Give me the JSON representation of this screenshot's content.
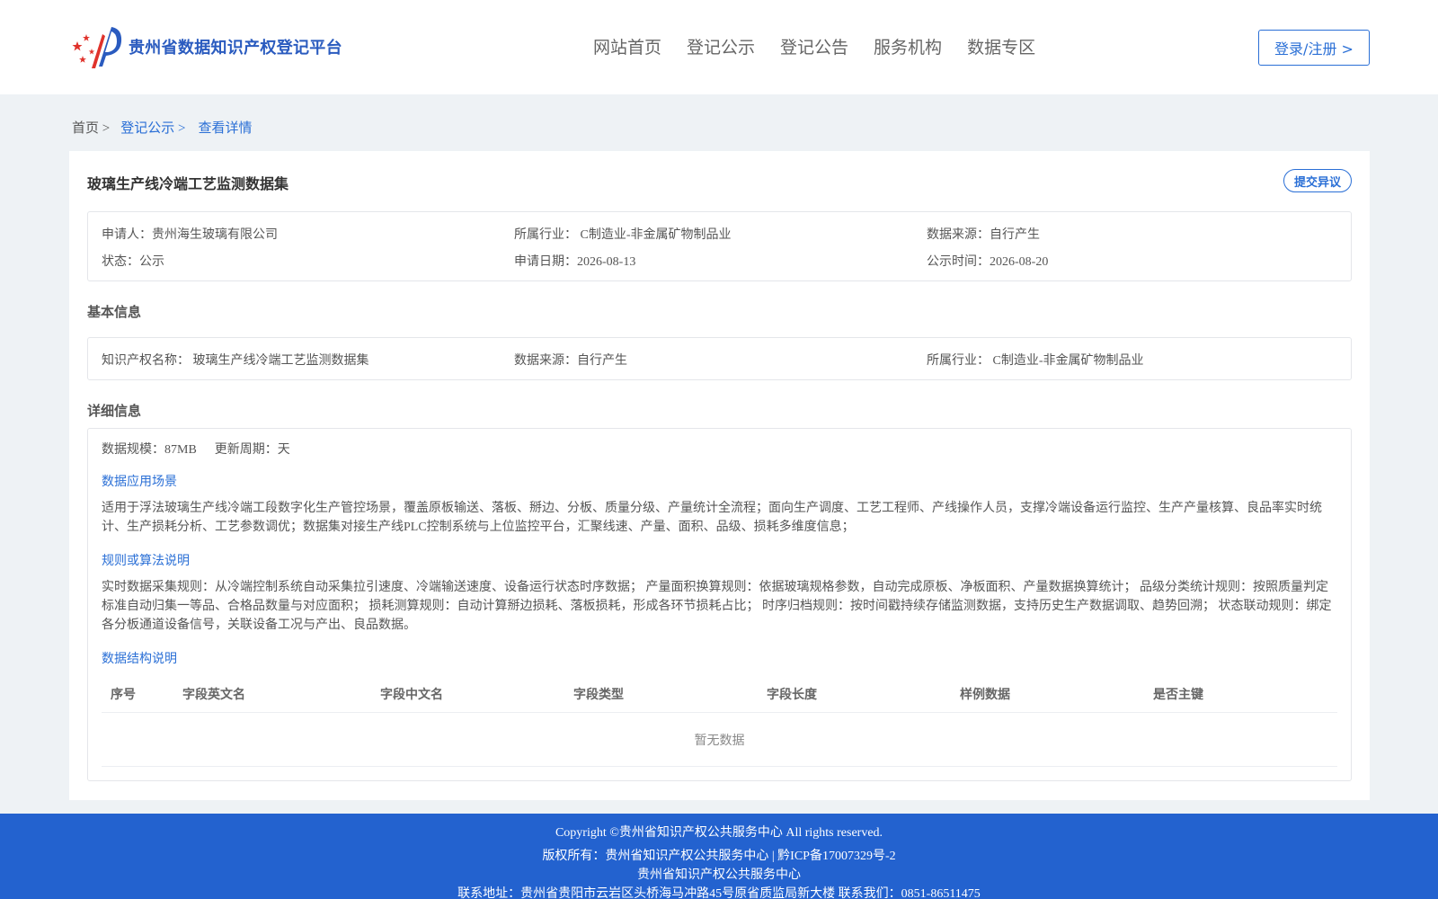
{
  "header": {
    "logo_text": "贵州省数据知识产权登记平台",
    "nav": [
      "网站首页",
      "登记公示",
      "登记公告",
      "服务机构",
      "数据专区"
    ],
    "login_label": "登录/注册 >"
  },
  "breadcrumb": {
    "home": "首页 >",
    "section": "登记公示 >",
    "current": "查看详情"
  },
  "record": {
    "title": "玻璃生产线冷端工艺监测数据集",
    "objection_label": "提交异议",
    "summary": {
      "applicant": "申请人：贵州海生玻璃有限公司",
      "industry": "所属行业： C制造业-非金属矿物制品业",
      "source": "数据来源：自行产生",
      "status": "状态：公示",
      "apply_date": "申请日期：2026-08-13",
      "publish_date": "公示时间：2026-08-20"
    },
    "basic_label": "基本信息",
    "basic": {
      "ip_name": "知识产权名称： 玻璃生产线冷端工艺监测数据集",
      "source": "数据来源：自行产生",
      "industry": "所属行业： C制造业-非金属矿物制品业"
    },
    "detail_label": "详细信息",
    "detail": {
      "scale": "数据规模：87MB",
      "cycle": "更新周期：天",
      "scenario_heading": "数据应用场景",
      "scenario_text": "适用于浮法玻璃生产线冷端工段数字化生产管控场景，覆盖原板输送、落板、掰边、分板、质量分级、产量统计全流程；面向生产调度、工艺工程师、产线操作人员，支撑冷端设备运行监控、生产产量核算、良品率实时统计、生产损耗分析、工艺参数调优；数据集对接生产线PLC控制系统与上位监控平台，汇聚线速、产量、面积、品级、损耗多维度信息；",
      "rules_heading": "规则或算法说明",
      "rules_text": "实时数据采集规则：从冷端控制系统自动采集拉引速度、冷端输送速度、设备运行状态时序数据； 产量面积换算规则：依据玻璃规格参数，自动完成原板、净板面积、产量数据换算统计； 品级分类统计规则：按照质量判定标准自动归集一等品、合格品数量与对应面积； 损耗测算规则：自动计算掰边损耗、落板损耗，形成各环节损耗占比； 时序归档规则：按时间戳持续存储监测数据，支持历史生产数据调取、趋势回溯； 状态联动规则：绑定各分板通道设备信号，关联设备工况与产出、良品数据。",
      "structure_heading": "数据结构说明",
      "table_headers": [
        "序号",
        "字段英文名",
        "字段中文名",
        "字段类型",
        "字段长度",
        "样例数据",
        "是否主键"
      ],
      "empty_text": "暂无数据"
    }
  },
  "footer": {
    "copyright": "Copyright ©贵州省知识产权公共服务中心 All rights reserved.",
    "owner": "版权所有：贵州省知识产权公共服务中心 | 黔ICP备17007329号-2",
    "org": "贵州省知识产权公共服务中心",
    "contact": "联系地址：贵州省贵阳市云岩区头桥海马冲路45号原省质监局新大楼 联系我们：0851-86511475"
  },
  "colors": {
    "accent": "#2a6fd6",
    "footer_bg": "#2362cf",
    "logo_red": "#e0322b"
  }
}
